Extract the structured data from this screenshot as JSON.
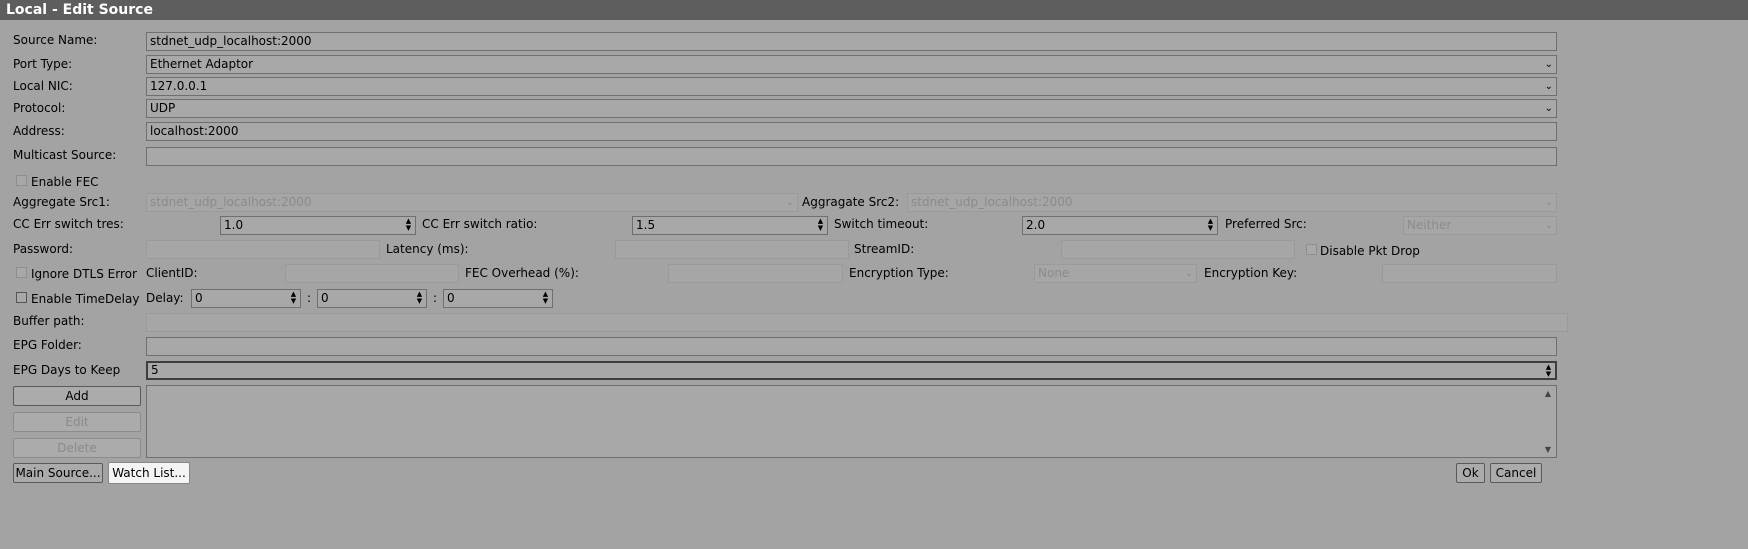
{
  "window": {
    "title": "Local - Edit Source"
  },
  "labels": {
    "source_name": "Source Name:",
    "port_type": "Port Type:",
    "local_nic": "Local NIC:",
    "protocol": "Protocol:",
    "address": "Address:",
    "multicast_source": "Multicast Source:",
    "enable_fec": "Enable FEC",
    "aggregate_src1": "Aggregate Src1:",
    "aggregate_src2": "Aggragate Src2:",
    "cc_err_switch_tres": "CC Err switch tres:",
    "cc_err_switch_ratio": "CC Err switch ratio:",
    "switch_timeout": "Switch timeout:",
    "preferred_src": "Preferred Src:",
    "password": "Password:",
    "latency": "Latency (ms):",
    "stream_id": "StreamID:",
    "disable_pkt_drop": "Disable Pkt Drop",
    "ignore_dtls_error": "Ignore DTLS Error",
    "client_id": "ClientID:",
    "fec_overhead": "FEC Overhead (%):",
    "encryption_type": "Encryption Type:",
    "encryption_key": "Encryption Key:",
    "enable_timedelay": "Enable TimeDelay",
    "delay": "Delay:",
    "colon": ":",
    "buffer_path": "Buffer path:",
    "epg_folder": "EPG Folder:",
    "epg_days_to_keep": "EPG Days to Keep"
  },
  "values": {
    "source_name": "stdnet_udp_localhost:2000",
    "port_type": "Ethernet Adaptor",
    "local_nic": "127.0.0.1",
    "protocol": "UDP",
    "address": "localhost:2000",
    "multicast_source": "",
    "aggregate_src1": "stdnet_udp_localhost:2000",
    "aggregate_src2": "stdnet_udp_localhost:2000",
    "cc_err_switch_tres": "1.0",
    "cc_err_switch_ratio": "1.5",
    "switch_timeout": "2.0",
    "preferred_src": "Neither",
    "password": "",
    "latency": "",
    "stream_id": "",
    "client_id": "",
    "fec_overhead": "",
    "encryption_type": "None",
    "encryption_key": "",
    "delay_h": "0",
    "delay_m": "0",
    "delay_s": "0",
    "buffer_path": "",
    "epg_folder": "",
    "epg_days_to_keep": "5"
  },
  "buttons": {
    "add": "Add",
    "edit": "Edit",
    "delete": "Delete",
    "main_source": "Main Source...",
    "watch_list": "Watch List...",
    "ok": "Ok",
    "cancel": "Cancel"
  },
  "icons": {
    "dropdown": "chevron-down-icon",
    "spinner": "spinner-arrows-icon",
    "scroll_up": "scroll-up-icon",
    "scroll_down": "scroll-down-icon"
  },
  "colors": {
    "background": "#a3a3a3",
    "titlebar": "#5e5e5e",
    "titlebar_text": "#ffffff"
  }
}
